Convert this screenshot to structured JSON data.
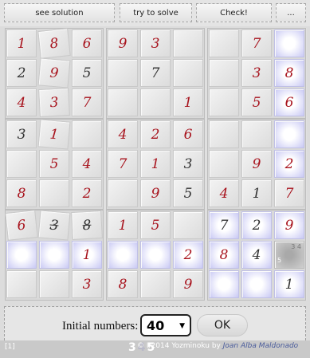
{
  "toolbar": {
    "buttons": [
      "see solution",
      "try to solve",
      "Check!",
      "..."
    ]
  },
  "grid": {
    "cells": [
      [
        {
          "v": "1",
          "t": "user"
        },
        {
          "v": "8",
          "t": "user"
        },
        {
          "v": "6",
          "t": "user"
        },
        {
          "v": "9",
          "t": "user"
        },
        {
          "v": "3",
          "t": "user"
        },
        {
          "v": "",
          "t": ""
        },
        {
          "v": "",
          "t": ""
        },
        {
          "v": "7",
          "t": "user"
        },
        {
          "v": "",
          "t": "",
          "hl": true
        }
      ],
      [
        {
          "v": "2",
          "t": "given"
        },
        {
          "v": "9",
          "t": "user"
        },
        {
          "v": "5",
          "t": "given"
        },
        {
          "v": "",
          "t": ""
        },
        {
          "v": "7",
          "t": "given"
        },
        {
          "v": "",
          "t": ""
        },
        {
          "v": "",
          "t": ""
        },
        {
          "v": "3",
          "t": "user"
        },
        {
          "v": "8",
          "t": "user",
          "hl": true
        }
      ],
      [
        {
          "v": "4",
          "t": "user"
        },
        {
          "v": "3",
          "t": "user"
        },
        {
          "v": "7",
          "t": "user"
        },
        {
          "v": "",
          "t": ""
        },
        {
          "v": "",
          "t": ""
        },
        {
          "v": "1",
          "t": "user"
        },
        {
          "v": "",
          "t": ""
        },
        {
          "v": "5",
          "t": "user"
        },
        {
          "v": "6",
          "t": "user",
          "hl": true
        }
      ],
      [
        {
          "v": "3",
          "t": "given"
        },
        {
          "v": "1",
          "t": "user"
        },
        {
          "v": "",
          "t": ""
        },
        {
          "v": "4",
          "t": "user"
        },
        {
          "v": "2",
          "t": "user"
        },
        {
          "v": "6",
          "t": "user"
        },
        {
          "v": "",
          "t": ""
        },
        {
          "v": "",
          "t": ""
        },
        {
          "v": "",
          "t": "",
          "hl": true
        }
      ],
      [
        {
          "v": "",
          "t": ""
        },
        {
          "v": "5",
          "t": "user"
        },
        {
          "v": "4",
          "t": "user"
        },
        {
          "v": "7",
          "t": "user"
        },
        {
          "v": "1",
          "t": "user"
        },
        {
          "v": "3",
          "t": "given"
        },
        {
          "v": "",
          "t": ""
        },
        {
          "v": "9",
          "t": "user"
        },
        {
          "v": "2",
          "t": "user",
          "hl": true
        }
      ],
      [
        {
          "v": "8",
          "t": "user"
        },
        {
          "v": "",
          "t": ""
        },
        {
          "v": "2",
          "t": "user"
        },
        {
          "v": "",
          "t": ""
        },
        {
          "v": "9",
          "t": "user"
        },
        {
          "v": "5",
          "t": "given"
        },
        {
          "v": "4",
          "t": "user"
        },
        {
          "v": "1",
          "t": "given"
        },
        {
          "v": "7",
          "t": "user"
        }
      ],
      [
        {
          "v": "6",
          "t": "user"
        },
        {
          "v": "3",
          "t": "given",
          "strike": true
        },
        {
          "v": "8",
          "t": "given",
          "strike": true
        },
        {
          "v": "1",
          "t": "user"
        },
        {
          "v": "5",
          "t": "user"
        },
        {
          "v": "",
          "t": ""
        },
        {
          "v": "7",
          "t": "given",
          "hl": true
        },
        {
          "v": "2",
          "t": "given",
          "hl": true
        },
        {
          "v": "9",
          "t": "user",
          "hl": true
        }
      ],
      [
        {
          "v": "",
          "t": "",
          "hl": true
        },
        {
          "v": "",
          "t": "",
          "hl": true
        },
        {
          "v": "1",
          "t": "user",
          "hl": true
        },
        {
          "v": "",
          "t": "",
          "hl": true
        },
        {
          "v": "",
          "t": "",
          "hl": true
        },
        {
          "v": "2",
          "t": "user",
          "hl": true
        },
        {
          "v": "8",
          "t": "user",
          "hl": true
        },
        {
          "v": "4",
          "t": "given",
          "hl": true
        },
        {
          "v": "",
          "t": "",
          "sel": true,
          "cands": "3 4",
          "cand_sel": "5"
        }
      ],
      [
        {
          "v": "",
          "t": ""
        },
        {
          "v": "",
          "t": ""
        },
        {
          "v": "3",
          "t": "user"
        },
        {
          "v": "8",
          "t": "user"
        },
        {
          "v": "",
          "t": ""
        },
        {
          "v": "9",
          "t": "user"
        },
        {
          "v": "",
          "t": "",
          "hl": true
        },
        {
          "v": "",
          "t": "",
          "hl": true
        },
        {
          "v": "1",
          "t": "given",
          "hl": true
        }
      ]
    ]
  },
  "controls": {
    "initial_label": "Initial numbers:",
    "initial_value": "40",
    "ok_label": "OK"
  },
  "footer": {
    "left": "[1]",
    "copyright": "© I/2014 Yozminoku by",
    "author": "Joan Alba Maldonado",
    "cands": [
      "3",
      "4",
      "5"
    ]
  }
}
